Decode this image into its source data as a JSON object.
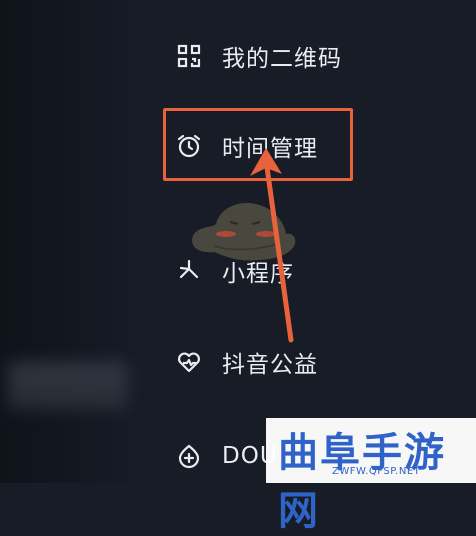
{
  "menu": {
    "items": [
      {
        "label": "我的二维码",
        "icon": "qr-code-icon"
      },
      {
        "label": "时间管理",
        "icon": "alarm-clock-icon"
      },
      {
        "label": "小程序",
        "icon": "mini-program-icon"
      },
      {
        "label": "抖音公益",
        "icon": "heart-charity-icon"
      },
      {
        "label": "DOU",
        "icon": "dou-plus-icon"
      }
    ]
  },
  "annotation": {
    "highlight_color": "#e8623b",
    "arrow_color": "#e8623b",
    "highlighted_item": "时间管理"
  },
  "watermark": {
    "title": "曲阜手游网",
    "url": "ZWFW.QFSP.NET",
    "color": "#2f63c8"
  },
  "colors": {
    "background": "#171c27",
    "text": "#eaecef"
  }
}
